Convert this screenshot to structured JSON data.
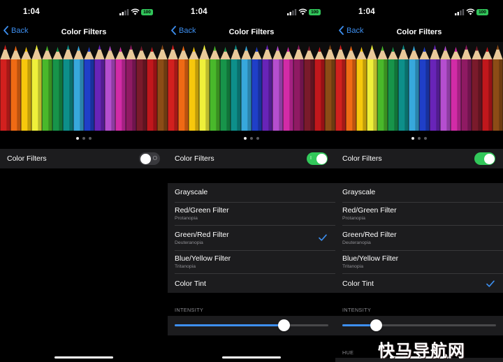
{
  "colors": {
    "accent": "#3d8ff0",
    "switch_on": "#32c85a",
    "battery": "#31c55a",
    "group_bg": "#1c1c1e"
  },
  "pencil_colors": [
    "#d2201e",
    "#ef6a14",
    "#f7c80c",
    "#eff03a",
    "#49b82b",
    "#17944a",
    "#0d8f8a",
    "#37a8dc",
    "#1f3fc8",
    "#6824b8",
    "#b54ecf",
    "#d22ba7",
    "#8f1a63",
    "#7a1a2b",
    "#c1171c",
    "#8c4c16"
  ],
  "watermark": "快马导航网",
  "screens": [
    {
      "status": {
        "time": "1:04",
        "battery": "100"
      },
      "nav": {
        "back": "Back",
        "title": "Color Filters"
      },
      "toggle": {
        "label": "Color Filters",
        "on": false,
        "mark": "O"
      }
    },
    {
      "status": {
        "time": "1:04",
        "battery": "100"
      },
      "nav": {
        "back": "Back",
        "title": "Color Filters"
      },
      "toggle": {
        "label": "Color Filters",
        "on": true,
        "mark": "I"
      },
      "options": [
        {
          "title": "Grayscale",
          "subtitle": ""
        },
        {
          "title": "Red/Green Filter",
          "subtitle": "Protanopia"
        },
        {
          "title": "Green/Red Filter",
          "subtitle": "Deuteranopia"
        },
        {
          "title": "Blue/Yellow Filter",
          "subtitle": "Tritanopia"
        },
        {
          "title": "Color Tint",
          "subtitle": ""
        }
      ],
      "selected_option": "Green/Red Filter",
      "intensity": {
        "label": "INTENSITY",
        "value": 0.71
      }
    },
    {
      "status": {
        "time": "1:04",
        "battery": "100"
      },
      "nav": {
        "back": "Back",
        "title": "Color Filters"
      },
      "toggle": {
        "label": "Color Filters",
        "on": true,
        "mark": ""
      },
      "options": [
        {
          "title": "Grayscale",
          "subtitle": ""
        },
        {
          "title": "Red/Green Filter",
          "subtitle": "Protanopia"
        },
        {
          "title": "Green/Red Filter",
          "subtitle": "Deuteranopia"
        },
        {
          "title": "Blue/Yellow Filter",
          "subtitle": "Tritanopia"
        },
        {
          "title": "Color Tint",
          "subtitle": ""
        }
      ],
      "selected_option": "Color Tint",
      "intensity": {
        "label": "INTENSITY",
        "value": 0.22
      },
      "hue": {
        "label": "HUE"
      }
    }
  ]
}
